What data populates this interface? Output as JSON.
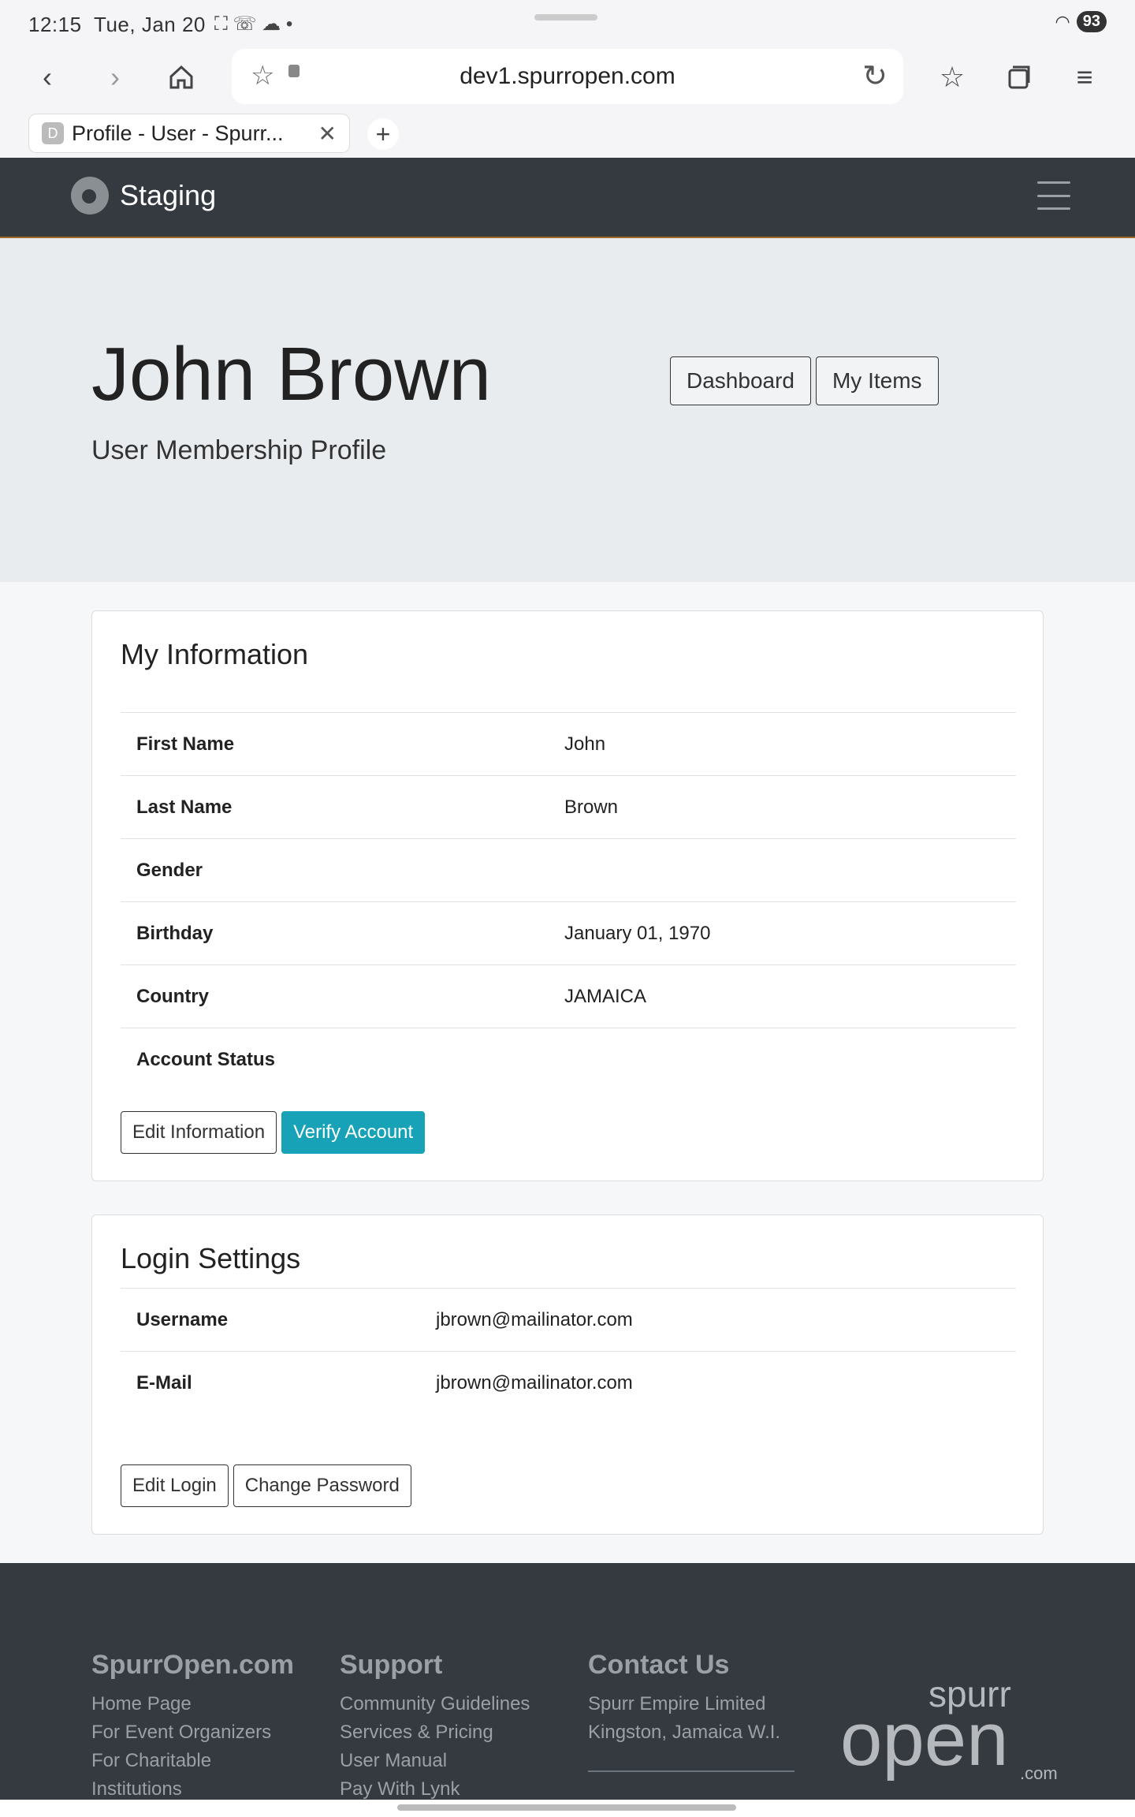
{
  "status": {
    "time": "12:15",
    "date": "Tue, Jan 20",
    "battery": "93"
  },
  "browser": {
    "url": "dev1.spurropen.com",
    "tab_title": "Profile - User - Spurr...",
    "tab_favicon": "D",
    "tab_count": "1"
  },
  "navbar": {
    "brand": "Staging"
  },
  "hero": {
    "name": "John Brown",
    "subtitle": "User Membership Profile",
    "buttons": {
      "dashboard": "Dashboard",
      "my_items": "My Items"
    }
  },
  "my_information": {
    "title": "My Information",
    "rows": [
      {
        "label": "First Name",
        "value": "John"
      },
      {
        "label": "Last Name",
        "value": "Brown"
      },
      {
        "label": "Gender",
        "value": ""
      },
      {
        "label": "Birthday",
        "value": "January 01, 1970"
      },
      {
        "label": "Country",
        "value": "JAMAICA"
      },
      {
        "label": "Account Status",
        "value": ""
      }
    ],
    "buttons": {
      "edit": "Edit Information",
      "verify": "Verify Account"
    }
  },
  "login_settings": {
    "title": "Login Settings",
    "rows": [
      {
        "label": "Username",
        "value": "jbrown@mailinator.com"
      },
      {
        "label": "E-Mail",
        "value": "jbrown@mailinator.com"
      }
    ],
    "buttons": {
      "edit_login": "Edit Login",
      "change_password": "Change Password"
    }
  },
  "footer": {
    "col1": {
      "title": "SpurrOpen.com",
      "links": [
        "Home Page",
        "For Event Organizers",
        "For Charitable",
        "Institutions"
      ]
    },
    "col2": {
      "title": "Support",
      "links": [
        "Community Guidelines",
        "Services & Pricing",
        "User Manual",
        "Pay With Lynk"
      ]
    },
    "col3": {
      "title": "Contact Us",
      "lines": [
        "Spurr Empire Limited",
        "Kingston, Jamaica W.I."
      ]
    },
    "logo_text": {
      "top": "spurr",
      "main": "open",
      "suffix": ".com"
    }
  },
  "colors": {
    "navbar_bg": "#343a40",
    "hero_bg": "#e9ecef",
    "verify_btn": "#17a2b8",
    "footer_bg": "#343a40"
  }
}
